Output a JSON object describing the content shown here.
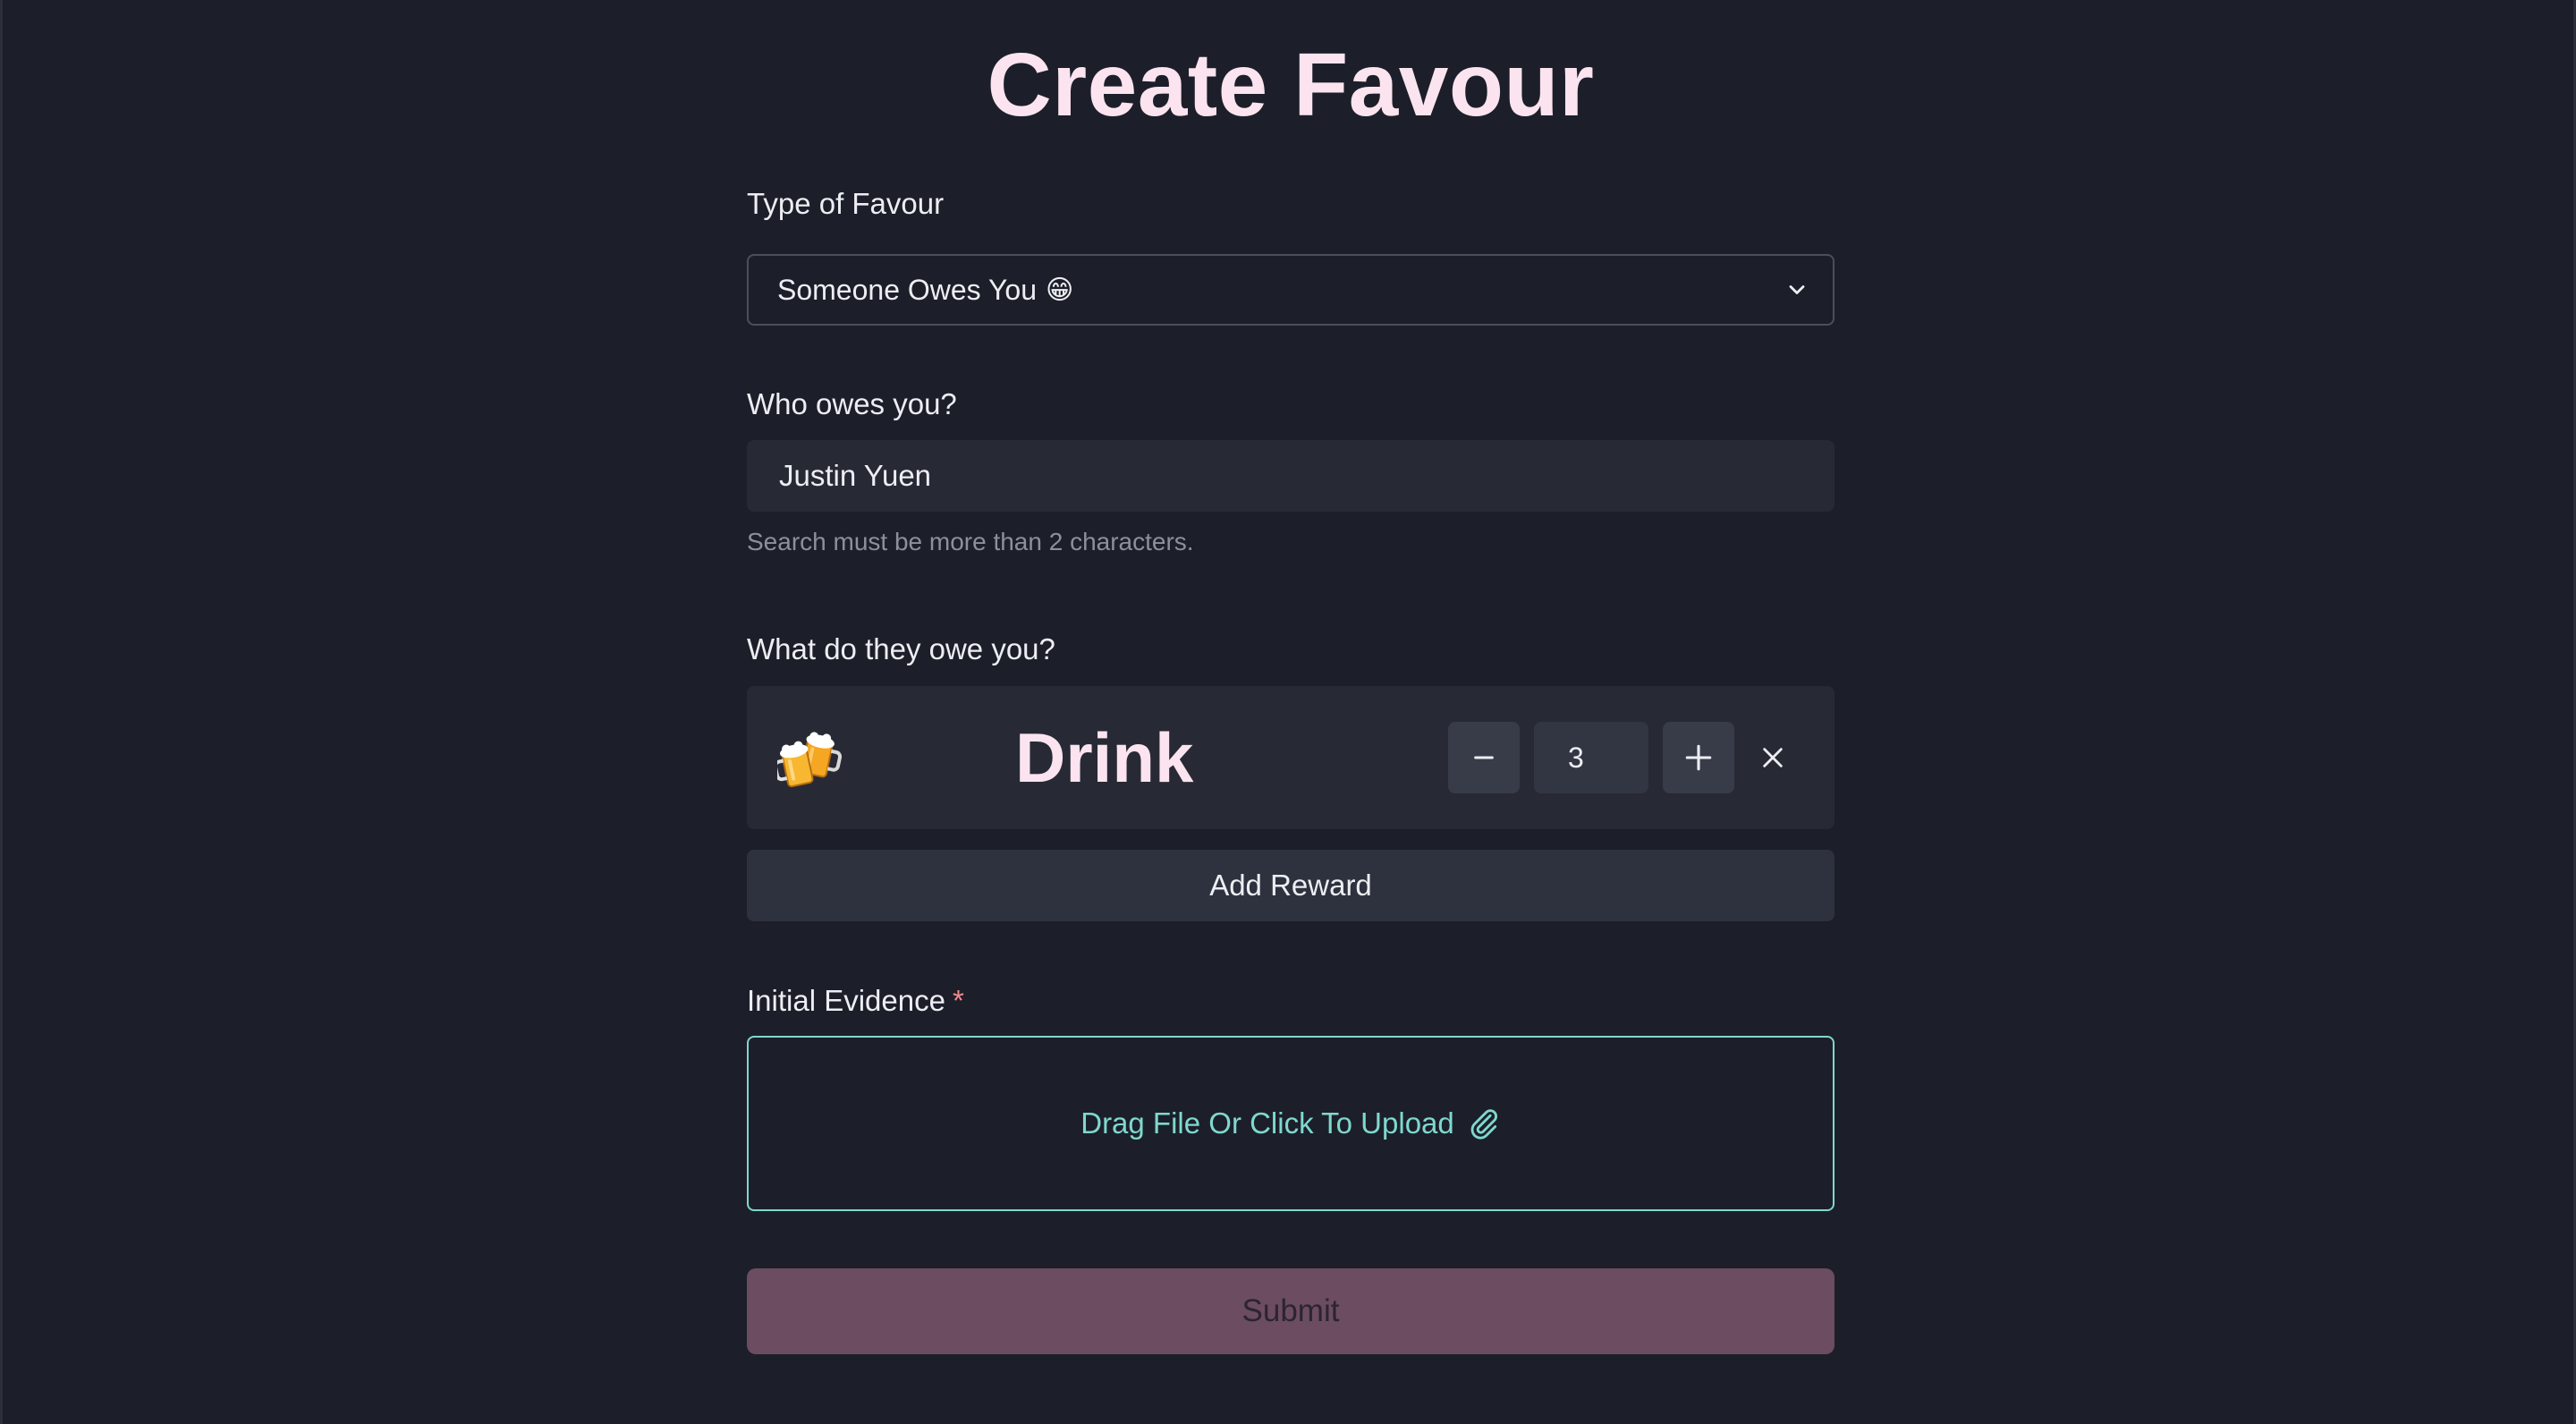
{
  "page": {
    "title": "Create Favour"
  },
  "favour_type": {
    "label": "Type of Favour",
    "selected_value": "Someone Owes You",
    "selected_emoji": "😁"
  },
  "who": {
    "label": "Who owes you?",
    "value": "Justin Yuen",
    "helper": "Search must be more than 2 characters."
  },
  "rewards": {
    "label": "What do they owe you?",
    "items": [
      {
        "name": "Drink",
        "icon": "beer-mugs-icon",
        "quantity": "3"
      }
    ],
    "add_label": "Add Reward"
  },
  "evidence": {
    "label": "Initial Evidence",
    "required_mark": "*",
    "upload_label": "Drag File Or Click To Upload"
  },
  "submit_label": "Submit",
  "colors": {
    "background": "#1c1f29",
    "title": "#fbe4ef",
    "accent_teal": "#7fd8cf",
    "submit": "#6c4c60",
    "required": "#f28b8b"
  }
}
